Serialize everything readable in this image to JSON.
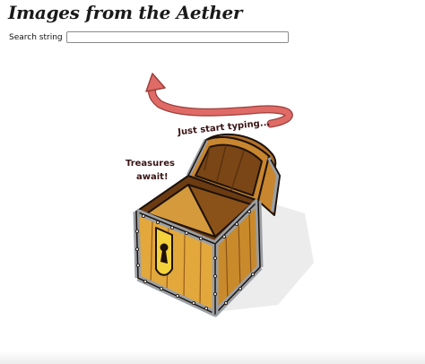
{
  "page": {
    "title": "Images from the Aether"
  },
  "search": {
    "label": "Search string",
    "value": "",
    "placeholder": ""
  },
  "illustration": {
    "hint_text": "Just start typing...",
    "treasure_line1": "Treasures",
    "treasure_line2": "await!",
    "icons": [
      "curved-arrow-icon",
      "treasure-chest-icon"
    ],
    "colors": {
      "arrow": "#e06b66",
      "wood": "#c8862f",
      "wood_dark": "#7a4616",
      "gold": "#f4d23c",
      "metal": "#9aa0a6",
      "text": "#3a1414"
    }
  }
}
